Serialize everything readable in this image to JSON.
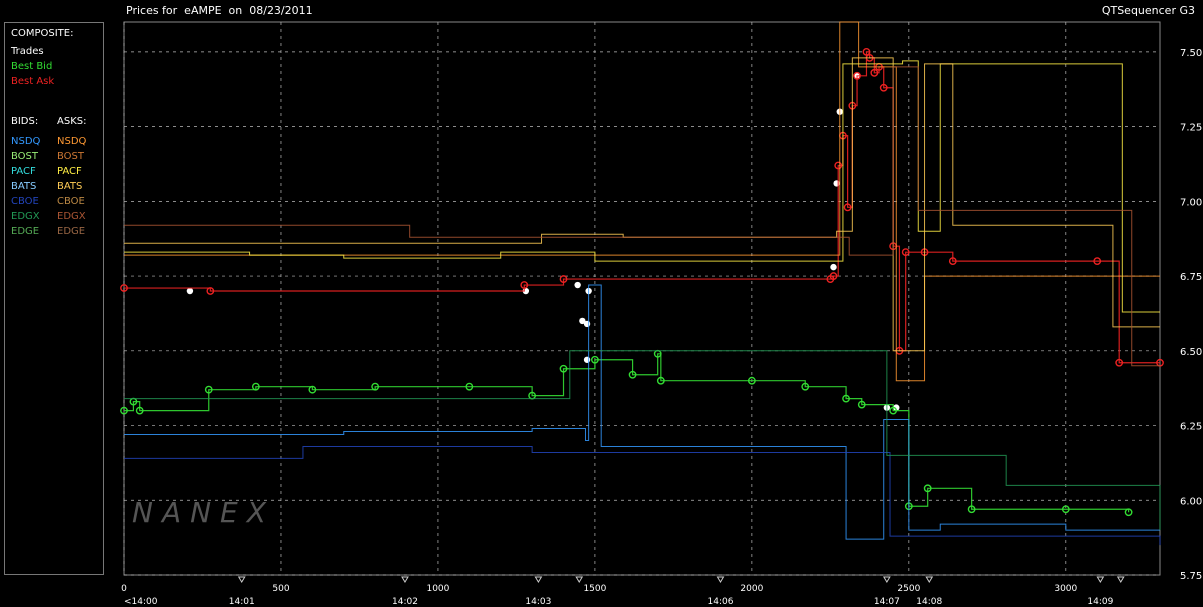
{
  "header": {
    "title": "Prices for  eAMPE  on  08/23/2011",
    "app_name": "QTSequencer G3"
  },
  "legend": {
    "composite_label": "COMPOSITE:",
    "composite_items": [
      {
        "label": "Trades",
        "color": "#ffffff"
      },
      {
        "label": "Best Bid",
        "color": "#33dd33"
      },
      {
        "label": "Best Ask",
        "color": "#ee2222"
      }
    ],
    "bids_label": "BIDS:",
    "asks_label": "ASKS:",
    "bids": [
      {
        "label": "NSDQ",
        "color": "#3399ff"
      },
      {
        "label": "BOST",
        "color": "#99ee77"
      },
      {
        "label": "PACF",
        "color": "#33dddd"
      },
      {
        "label": "BATS",
        "color": "#88ccff"
      },
      {
        "label": "CBOE",
        "color": "#2244bb"
      },
      {
        "label": "EDGX",
        "color": "#229955"
      },
      {
        "label": "EDGE",
        "color": "#55aa55"
      }
    ],
    "asks": [
      {
        "label": "NSDQ",
        "color": "#ff9933"
      },
      {
        "label": "BOST",
        "color": "#cc7733"
      },
      {
        "label": "PACF",
        "color": "#ffee44"
      },
      {
        "label": "BATS",
        "color": "#ffcc55"
      },
      {
        "label": "CBOE",
        "color": "#bb8844"
      },
      {
        "label": "EDGX",
        "color": "#aa5533"
      },
      {
        "label": "EDGE",
        "color": "#996644"
      }
    ]
  },
  "watermark": "NANEX",
  "chart_data": {
    "type": "line",
    "title": "Prices for  eAMPE  on  08/23/2011",
    "y_ticks": [
      "5.75",
      "6.00",
      "6.25",
      "6.50",
      "6.75",
      "7.00",
      "7.25",
      "7.50"
    ],
    "y_values": [
      5.75,
      6.0,
      6.25,
      6.5,
      6.75,
      7.0,
      7.25,
      7.5
    ],
    "ylim": [
      5.75,
      7.6
    ],
    "x_ticks": [
      "0",
      "500",
      "1000",
      "1500",
      "2000",
      "2500",
      "3000"
    ],
    "x_values": [
      0,
      500,
      1000,
      1500,
      2000,
      2500,
      3000
    ],
    "xlim": [
      0,
      3300
    ],
    "time_labels": [
      {
        "label": "<14:00",
        "x": 0
      },
      {
        "label": "14:01",
        "x": 375
      },
      {
        "label": "14:02",
        "x": 895
      },
      {
        "label": "14:03",
        "x": 1320
      },
      {
        "label": "14:06",
        "x": 1900
      },
      {
        "label": "14:07",
        "x": 2430
      },
      {
        "label": "14:08",
        "x": 2565
      },
      {
        "label": "14:09",
        "x": 3110
      }
    ],
    "time_markers": [
      375,
      895,
      1320,
      1450,
      1900,
      2430,
      2565,
      3110,
      3175
    ],
    "grid": true,
    "series": [
      {
        "name": "Trades",
        "color": "#ffffff",
        "points": [
          [
            210,
            6.7
          ],
          [
            1280,
            6.7
          ],
          [
            1445,
            6.72
          ],
          [
            1460,
            6.6
          ],
          [
            1475,
            6.59
          ],
          [
            1475,
            6.47
          ],
          [
            1480,
            6.7
          ],
          [
            2260,
            6.78
          ],
          [
            2270,
            7.06
          ],
          [
            2280,
            7.3
          ],
          [
            2335,
            7.42
          ],
          [
            2430,
            6.31
          ],
          [
            2460,
            6.31
          ]
        ]
      },
      {
        "name": "Best Ask",
        "color": "#ee2222",
        "points": [
          [
            0,
            6.71
          ],
          [
            275,
            6.7
          ],
          [
            1275,
            6.72
          ],
          [
            1400,
            6.74
          ],
          [
            2250,
            6.74
          ],
          [
            2260,
            6.75
          ],
          [
            2275,
            7.12
          ],
          [
            2290,
            7.22
          ],
          [
            2305,
            6.98
          ],
          [
            2320,
            7.32
          ],
          [
            2335,
            7.42
          ],
          [
            2365,
            7.5
          ],
          [
            2375,
            7.48
          ],
          [
            2390,
            7.43
          ],
          [
            2405,
            7.45
          ],
          [
            2420,
            7.38
          ],
          [
            2450,
            6.85
          ],
          [
            2470,
            6.5
          ],
          [
            2490,
            6.83
          ],
          [
            2550,
            6.83
          ],
          [
            2640,
            6.8
          ],
          [
            3100,
            6.8
          ],
          [
            3170,
            6.46
          ],
          [
            3300,
            6.46
          ]
        ]
      },
      {
        "name": "Best Bid",
        "color": "#33dd33",
        "points": [
          [
            0,
            6.3
          ],
          [
            30,
            6.33
          ],
          [
            50,
            6.3
          ],
          [
            270,
            6.37
          ],
          [
            420,
            6.38
          ],
          [
            600,
            6.37
          ],
          [
            800,
            6.38
          ],
          [
            1100,
            6.38
          ],
          [
            1300,
            6.35
          ],
          [
            1400,
            6.44
          ],
          [
            1500,
            6.47
          ],
          [
            1620,
            6.42
          ],
          [
            1700,
            6.49
          ],
          [
            1710,
            6.4
          ],
          [
            2000,
            6.4
          ],
          [
            2170,
            6.38
          ],
          [
            2300,
            6.34
          ],
          [
            2350,
            6.32
          ],
          [
            2450,
            6.3
          ],
          [
            2500,
            5.98
          ],
          [
            2560,
            6.04
          ],
          [
            2700,
            5.97
          ],
          [
            3000,
            5.97
          ],
          [
            3200,
            5.96
          ]
        ]
      },
      {
        "name": "NSDQ ask",
        "color": "#ff9933",
        "points": [
          [
            0,
            6.82
          ],
          [
            2270,
            6.82
          ],
          [
            2280,
            7.6
          ],
          [
            2330,
            7.6
          ],
          [
            2340,
            7.45
          ],
          [
            2450,
            7.45
          ],
          [
            2460,
            6.4
          ],
          [
            2550,
            6.75
          ],
          [
            3300,
            6.75
          ]
        ]
      },
      {
        "name": "PACF ask",
        "color": "#ffee44",
        "points": [
          [
            0,
            6.83
          ],
          [
            400,
            6.82
          ],
          [
            700,
            6.81
          ],
          [
            1200,
            6.83
          ],
          [
            1500,
            6.8
          ],
          [
            2270,
            6.8
          ],
          [
            2290,
            7.46
          ],
          [
            2480,
            7.47
          ],
          [
            2530,
            6.9
          ],
          [
            2600,
            7.46
          ],
          [
            3150,
            7.46
          ],
          [
            3180,
            6.63
          ],
          [
            3300,
            6.63
          ]
        ]
      },
      {
        "name": "BATS ask",
        "color": "#ffcc55",
        "points": [
          [
            0,
            6.86
          ],
          [
            1300,
            6.86
          ],
          [
            1330,
            6.89
          ],
          [
            1580,
            6.89
          ],
          [
            1590,
            6.88
          ],
          [
            2260,
            6.88
          ],
          [
            2270,
            6.9
          ],
          [
            2320,
            7.48
          ],
          [
            2430,
            7.48
          ],
          [
            2450,
            6.5
          ],
          [
            2550,
            7.46
          ],
          [
            2640,
            6.92
          ],
          [
            3050,
            6.92
          ],
          [
            3150,
            6.58
          ],
          [
            3300,
            6.58
          ]
        ]
      },
      {
        "name": "EDGX ask",
        "color": "#aa5533",
        "points": [
          [
            0,
            6.92
          ],
          [
            900,
            6.92
          ],
          [
            910,
            6.88
          ],
          [
            2300,
            6.88
          ],
          [
            2310,
            6.82
          ],
          [
            2430,
            6.82
          ],
          [
            2450,
            7.45
          ],
          [
            2520,
            7.45
          ],
          [
            2530,
            6.97
          ],
          [
            3200,
            6.97
          ],
          [
            3210,
            6.45
          ],
          [
            3300,
            6.45
          ]
        ]
      },
      {
        "name": "NSDQ bid",
        "color": "#3399ff",
        "points": [
          [
            0,
            6.22
          ],
          [
            700,
            6.23
          ],
          [
            1300,
            6.24
          ],
          [
            1470,
            6.2
          ],
          [
            1480,
            6.72
          ],
          [
            1520,
            6.18
          ],
          [
            2200,
            6.18
          ],
          [
            2300,
            5.87
          ],
          [
            2410,
            5.87
          ],
          [
            2420,
            6.27
          ],
          [
            2500,
            5.9
          ],
          [
            2600,
            5.92
          ],
          [
            3000,
            5.9
          ],
          [
            3300,
            5.9
          ]
        ]
      },
      {
        "name": "CBOE bid",
        "color": "#2244bb",
        "points": [
          [
            0,
            6.14
          ],
          [
            560,
            6.14
          ],
          [
            570,
            6.18
          ],
          [
            1290,
            6.18
          ],
          [
            1300,
            6.16
          ],
          [
            2430,
            6.16
          ],
          [
            2440,
            5.88
          ],
          [
            3300,
            5.85
          ]
        ]
      },
      {
        "name": "EDGX bid",
        "color": "#229955",
        "points": [
          [
            0,
            6.34
          ],
          [
            1400,
            6.34
          ],
          [
            1420,
            6.5
          ],
          [
            2420,
            6.5
          ],
          [
            2430,
            6.15
          ],
          [
            2800,
            6.15
          ],
          [
            2810,
            6.05
          ],
          [
            3300,
            5.9
          ]
        ]
      }
    ]
  }
}
